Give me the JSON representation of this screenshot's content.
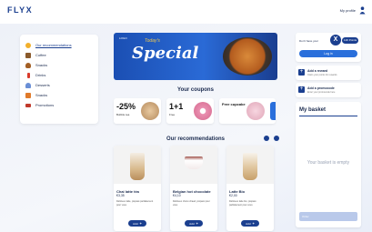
{
  "header": {
    "logo": "FLYX",
    "profile": "My profile"
  },
  "sidebar": {
    "items": [
      {
        "label": "Our recommendations",
        "color": "#f2b02c",
        "active": true
      },
      {
        "label": "Coffee",
        "color": "#8a5a2b"
      },
      {
        "label": "Snacks",
        "color": "#a35f24"
      },
      {
        "label": "Drinks",
        "color": "#d93a2b"
      },
      {
        "label": "Desserts",
        "color": "#6a8fd6"
      },
      {
        "label": "Snacks",
        "color": "#e07a2a"
      },
      {
        "label": "Promotions",
        "color": "#c0392b"
      }
    ]
  },
  "banner": {
    "headline": "Special",
    "small": "Today's",
    "logo": "LOGO"
  },
  "coupons": {
    "title": "Your coupons",
    "items": [
      {
        "big": "-25%",
        "sub": "Bubble tea"
      },
      {
        "big": "1+1",
        "sub": "Free"
      },
      {
        "big": "Free cupcake",
        "sub": ""
      }
    ]
  },
  "recommendations": {
    "title": "Our recommendations",
    "products": [
      {
        "name": "Chai latte tèa",
        "price": "€3,35",
        "desc": "Délicieux latte, préparé parfaitement pour vous",
        "add": "Add"
      },
      {
        "name": "Belgian hot chocolate",
        "price": "€4,10",
        "desc": "Délicieux choco chaud, préparé pour vous",
        "add": "Add"
      },
      {
        "name": "Latte Bio",
        "price": "€2,00",
        "desc": "Délicieux latte bio, préparé parfaitement pour vous",
        "add": "Add"
      }
    ]
  },
  "loyalty": {
    "text": "Don't have your",
    "points": "120 Points",
    "login": "Log in"
  },
  "promos": [
    {
      "title": "Add a reward",
      "sub": "Claim your points for rewards"
    },
    {
      "title": "Add a promocode",
      "sub": "Enter your promocode here"
    }
  ],
  "basket": {
    "title": "My basket",
    "empty": "Your basket is empty",
    "order": "Order"
  },
  "colors": {
    "primary": "#1b3f8f",
    "accent": "#2a6fdb"
  }
}
